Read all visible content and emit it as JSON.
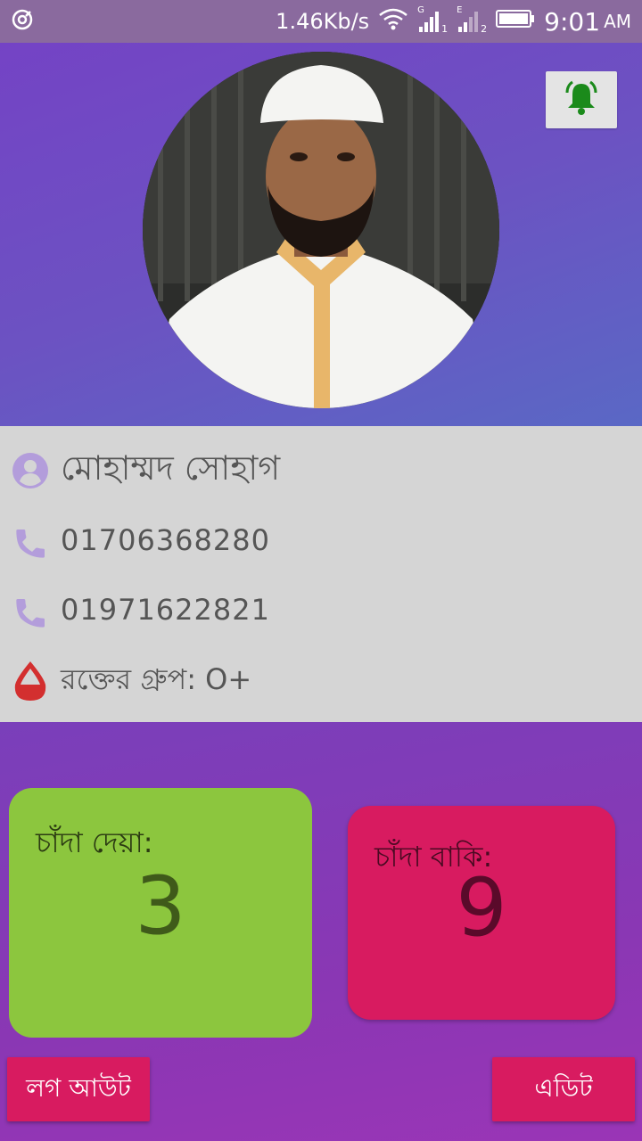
{
  "status_bar": {
    "speed": "1.46Kb/s",
    "time": "9:01",
    "ampm": "AM",
    "sim1_label": "G",
    "sim2_label": "E",
    "sim1_index": "1",
    "sim2_index": "2"
  },
  "profile": {
    "name": "মোহাম্মদ সোহাগ",
    "phone1": "01706368280",
    "phone2": "01971622821",
    "blood_group": "রক্তের গ্রুপ: O+"
  },
  "stats": {
    "paid_label": "চাঁদা দেয়া:",
    "paid_value": "3",
    "due_label": "চাঁদা বাকি:",
    "due_value": "9"
  },
  "buttons": {
    "logout": "লগ আউট",
    "edit": "এডিট"
  },
  "colors": {
    "accent": "#d81b60",
    "paid_card": "#8cc63e",
    "icon": "#b39ddb",
    "bell": "#1b8a1b",
    "blood": "#d32f2f"
  },
  "icons": [
    "notification-icon",
    "bell-icon",
    "wifi-icon",
    "signal-icon",
    "battery-icon",
    "person-icon",
    "phone-icon",
    "blood-drop-icon"
  ]
}
